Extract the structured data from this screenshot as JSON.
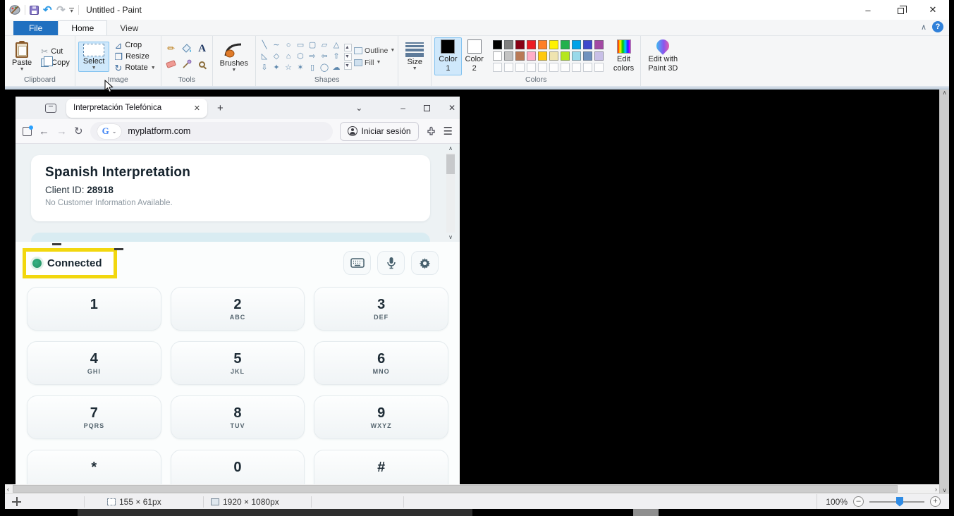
{
  "paint": {
    "title": "Untitled - Paint",
    "tabs": {
      "file": "File",
      "home": "Home",
      "view": "View"
    },
    "clipboard": {
      "label": "Clipboard",
      "paste": "Paste",
      "cut": "Cut",
      "copy": "Copy"
    },
    "image": {
      "label": "Image",
      "select": "Select",
      "crop": "Crop",
      "resize": "Resize",
      "rotate": "Rotate"
    },
    "tools": {
      "label": "Tools",
      "text_tool": "A"
    },
    "brushes": {
      "label": "Brushes"
    },
    "shapes": {
      "label": "Shapes",
      "outline": "Outline",
      "fill": "Fill",
      "names": [
        "line",
        "curve",
        "oval",
        "rectangle",
        "rounded-rectangle",
        "polygon",
        "triangle",
        "right-triangle",
        "diamond",
        "pentagon",
        "hexagon",
        "right-arrow",
        "left-arrow",
        "up-arrow",
        "down-arrow",
        "four-point-star",
        "five-point-star",
        "six-point-star",
        "rounded-callout",
        "oval-callout",
        "cloud-callout"
      ],
      "glyphs": [
        "╲",
        "∼",
        "○",
        "▭",
        "▢",
        "▱",
        "△",
        "◺",
        "◇",
        "⌂",
        "⬡",
        "⇨",
        "⇦",
        "⇧",
        "⇩",
        "✦",
        "☆",
        "✶",
        "▯",
        "◯",
        "☁"
      ]
    },
    "size": {
      "label": "Size"
    },
    "colors": {
      "label": "Colors",
      "color1_label": "Color\n1",
      "color2_label": "Color\n2",
      "color1": "#000000",
      "color2": "#FFFFFF",
      "edit_colors": "Edit\ncolors",
      "palette": [
        "#000000",
        "#7F7F7F",
        "#880015",
        "#ED1C24",
        "#FF7F27",
        "#FFF200",
        "#22B14C",
        "#00A2E8",
        "#3F48CC",
        "#A349A4",
        "#FFFFFF",
        "#C3C3C3",
        "#B97A57",
        "#FFAEC9",
        "#FFC90E",
        "#EFE4B0",
        "#B5E61D",
        "#99D9EA",
        "#7092BE",
        "#C8BFE7"
      ],
      "empty_slots": 10
    },
    "paint3d": {
      "label": "Edit with\nPaint 3D"
    },
    "statusbar": {
      "selection_size": "155 × 61px",
      "image_size": "1920 × 1080px",
      "zoom": "100%"
    }
  },
  "browser": {
    "tab_title": "Interpretación Telefónica",
    "url": "myplatform.com",
    "signin_label": "Iniciar sesión"
  },
  "page": {
    "heading": "Spanish Interpretation",
    "client_label": "Client ID:",
    "client_id": "28918",
    "info": "No Customer Information Available."
  },
  "dialer": {
    "status": "Connected",
    "status_color": "#2AA876",
    "highlight_color": "#F2D70E",
    "keys": [
      {
        "digit": "1",
        "letters": ""
      },
      {
        "digit": "2",
        "letters": "ABC"
      },
      {
        "digit": "3",
        "letters": "DEF"
      },
      {
        "digit": "4",
        "letters": "GHI"
      },
      {
        "digit": "5",
        "letters": "JKL"
      },
      {
        "digit": "6",
        "letters": "MNO"
      },
      {
        "digit": "7",
        "letters": "PQRS"
      },
      {
        "digit": "8",
        "letters": "TUV"
      },
      {
        "digit": "9",
        "letters": "WXYZ"
      },
      {
        "digit": "*",
        "letters": ""
      },
      {
        "digit": "0",
        "letters": ""
      },
      {
        "digit": "#",
        "letters": ""
      }
    ]
  }
}
